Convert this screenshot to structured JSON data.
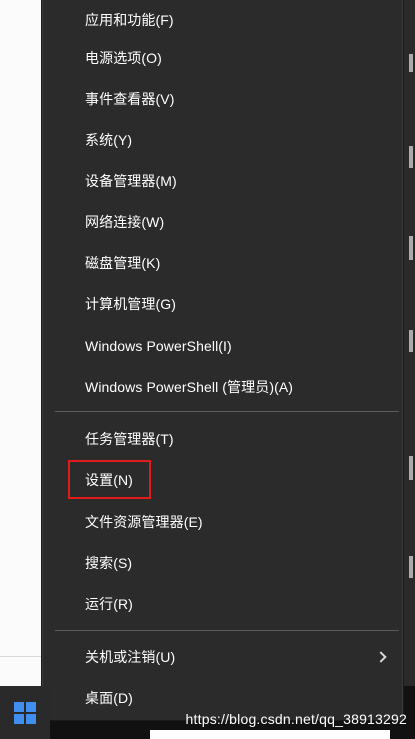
{
  "menu": {
    "items": [
      {
        "label": "应用和功能(F)"
      },
      {
        "label": "电源选项(O)"
      },
      {
        "label": "事件查看器(V)"
      },
      {
        "label": "系统(Y)"
      },
      {
        "label": "设备管理器(M)"
      },
      {
        "label": "网络连接(W)"
      },
      {
        "label": "磁盘管理(K)"
      },
      {
        "label": "计算机管理(G)"
      },
      {
        "label": "Windows PowerShell(I)"
      },
      {
        "label": "Windows PowerShell (管理员)(A)"
      },
      {
        "label": "任务管理器(T)"
      },
      {
        "label": "设置(N)"
      },
      {
        "label": "文件资源管理器(E)"
      },
      {
        "label": "搜索(S)"
      },
      {
        "label": "运行(R)"
      },
      {
        "label": "关机或注销(U)"
      },
      {
        "label": "桌面(D)"
      }
    ]
  },
  "watermark": "https://blog.csdn.net/qq_38913292",
  "icons": {
    "start": "windows-logo",
    "submenu": "chevron-right"
  },
  "colors": {
    "menu_bg": "#2b2b2b",
    "text": "#ffffff",
    "highlight": "#e21b1b",
    "start_logo": "#3f8ef0"
  }
}
